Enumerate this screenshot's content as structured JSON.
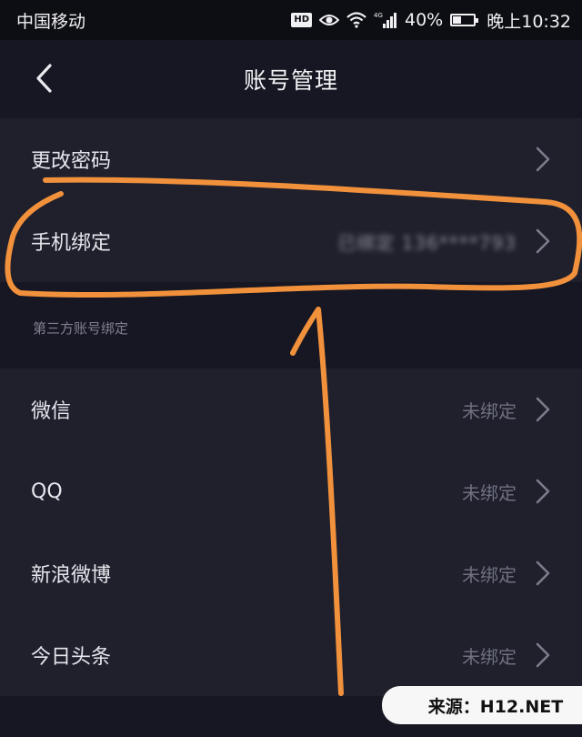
{
  "status_bar": {
    "carrier": "中国移动",
    "hd": "HD",
    "network": "4G",
    "battery": "40%",
    "battery_level": 0.4,
    "time": "晚上10:32"
  },
  "nav": {
    "title": "账号管理",
    "back_icon": "chevron-left-icon"
  },
  "account_rows": [
    {
      "label": "更改密码",
      "value": ""
    },
    {
      "label": "手机绑定",
      "value": "已绑定 136****793"
    }
  ],
  "third_party": {
    "header": "第三方账号绑定",
    "rows": [
      {
        "label": "微信",
        "value": "未绑定"
      },
      {
        "label": "QQ",
        "value": "未绑定"
      },
      {
        "label": "新浪微博",
        "value": "未绑定"
      },
      {
        "label": "今日头条",
        "value": "未绑定"
      }
    ]
  },
  "watermark": {
    "text": "来源：H12.NET"
  },
  "colors": {
    "background": "#161722",
    "row_background": "#1f202c",
    "annotation_orange": "#f2913c"
  }
}
